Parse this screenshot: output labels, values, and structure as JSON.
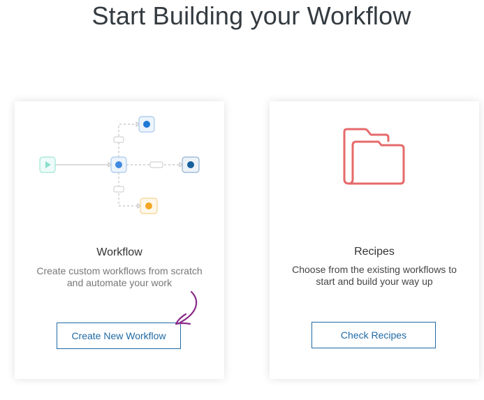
{
  "page": {
    "title": "Start Building your Workflow"
  },
  "cards": {
    "workflow": {
      "title": "Workflow",
      "description": "Create custom workflows from scratch and automate your work",
      "button_label": "Create New Workflow",
      "illustration": "workflow-diagram-icon"
    },
    "recipes": {
      "title": "Recipes",
      "description": "Choose from the existing workflows to start and build your way up",
      "button_label": "Check Recipes",
      "illustration": "folder-icon"
    }
  },
  "colors": {
    "button_border": "#1f6aa5",
    "folder": "#e66a6a",
    "node_blue": "#1f7ad6",
    "node_dark_blue": "#16609e",
    "node_orange": "#f5a623",
    "node_teal": "#7ddbc9",
    "annotation_arrow": "#8a2b8a"
  }
}
